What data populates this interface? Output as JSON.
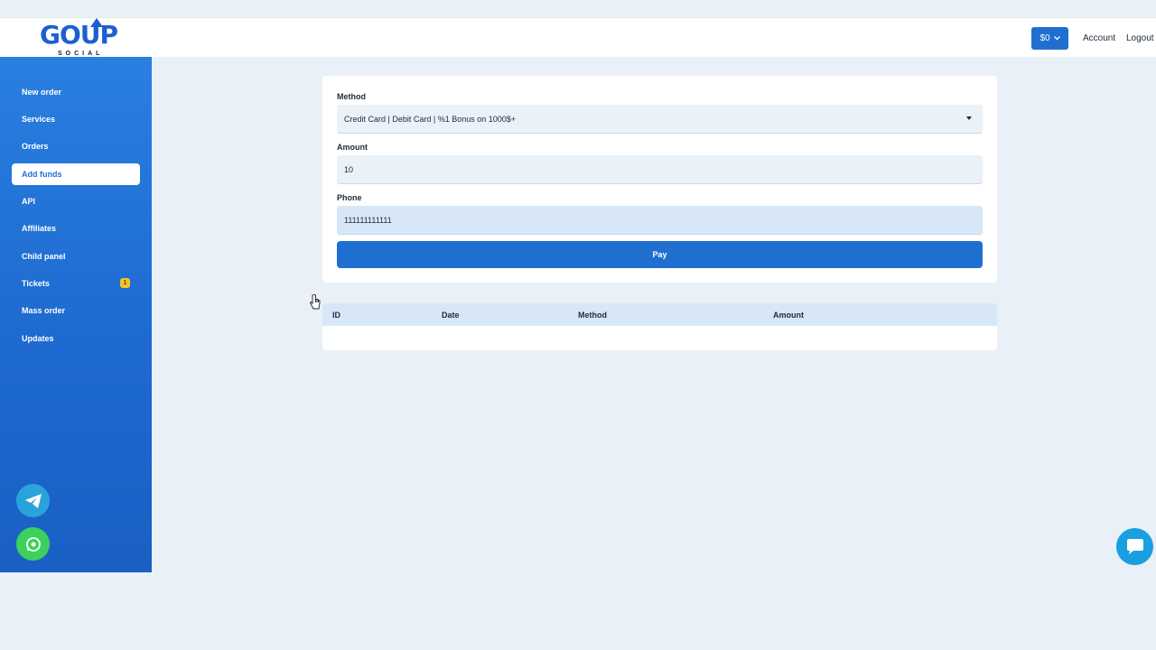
{
  "brand": {
    "logo_text": "GOUP",
    "logo_subtext": "SOCIAL",
    "primary_color": "#1f6fd1"
  },
  "header": {
    "balance": "$0",
    "account_label": "Account",
    "logout_label": "Logout"
  },
  "sidebar": {
    "items": [
      {
        "label": "New order"
      },
      {
        "label": "Services"
      },
      {
        "label": "Orders"
      },
      {
        "label": "Add funds",
        "active": true
      },
      {
        "label": "API"
      },
      {
        "label": "Affiliates"
      },
      {
        "label": "Child panel"
      },
      {
        "label": "Tickets",
        "badge": "1"
      },
      {
        "label": "Mass order"
      },
      {
        "label": "Updates"
      }
    ],
    "floating_icons": [
      "telegram-icon",
      "whatsapp-icon"
    ]
  },
  "form": {
    "method_label": "Method",
    "method_value": "Credit Card | Debit Card | %1 Bonus on 1000$+",
    "amount_label": "Amount",
    "amount_value": "10",
    "phone_label": "Phone",
    "phone_value": "111111111111",
    "pay_label": "Pay"
  },
  "history_table": {
    "columns": [
      "ID",
      "Date",
      "Method",
      "Amount"
    ],
    "rows": []
  },
  "chat_widget": {
    "icon": "chat-bubble-icon"
  }
}
